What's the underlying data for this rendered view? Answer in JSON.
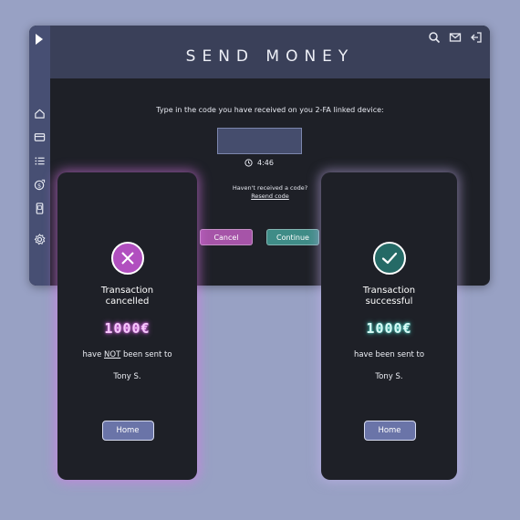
{
  "header": {
    "title": "SEND MONEY",
    "icons": [
      "search-icon",
      "mail-icon",
      "logout-icon"
    ]
  },
  "sidebar": {
    "toggle_icon": "play-icon",
    "items": [
      "home-icon",
      "card-icon",
      "list-icon",
      "money-transfer-icon",
      "phone-icon",
      "settings-icon"
    ]
  },
  "verification": {
    "prompt": "Type in the code you have received on you 2-FA linked device:",
    "code_value": "",
    "timer": "4:46",
    "not_received": "Haven't received a code?",
    "resend_link": "Resend code",
    "cancel_label": "Cancel",
    "continue_label": "Continue"
  },
  "cancelled_card": {
    "title_line1": "Transaction",
    "title_line2": "cancelled",
    "amount": "1000€",
    "msg_before": "have ",
    "msg_emph": "NOT",
    "msg_after": " been sent to",
    "recipient": "Tony S.",
    "home_label": "Home"
  },
  "success_card": {
    "title_line1": "Transaction",
    "title_line2": "successful",
    "amount": "1000€",
    "msg": "have been sent to",
    "recipient": "Tony S.",
    "home_label": "Home"
  },
  "colors": {
    "background": "#98a1c4",
    "panel": "#1e2027",
    "cancel": "#a654a8",
    "continue": "#3f8c87",
    "home": "#6a74a8"
  }
}
